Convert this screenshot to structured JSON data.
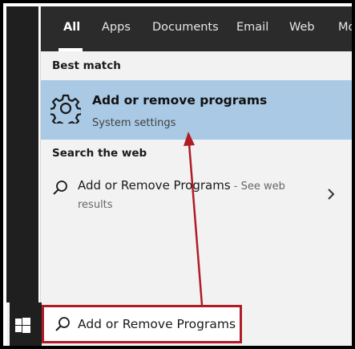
{
  "tabs": [
    {
      "label": "All"
    },
    {
      "label": "Apps"
    },
    {
      "label": "Documents"
    },
    {
      "label": "Email"
    },
    {
      "label": "Web"
    },
    {
      "label": "Mo"
    }
  ],
  "best_match": {
    "heading": "Best match",
    "title": "Add or remove programs",
    "subtitle": "System settings"
  },
  "search_web": {
    "heading": "Search the web",
    "title": "Add or Remove Programs",
    "suffix": " - See web",
    "sub": "results"
  },
  "search_box": {
    "value": "Add or Remove Programs"
  },
  "colors": {
    "highlight": "#a9c9e5",
    "tabbar": "#2b2b2b",
    "annotation": "#b01c25"
  },
  "icons": {
    "settings": "gear-icon",
    "search": "search-icon",
    "chevron": "chevron-right-icon",
    "start": "windows-icon"
  }
}
